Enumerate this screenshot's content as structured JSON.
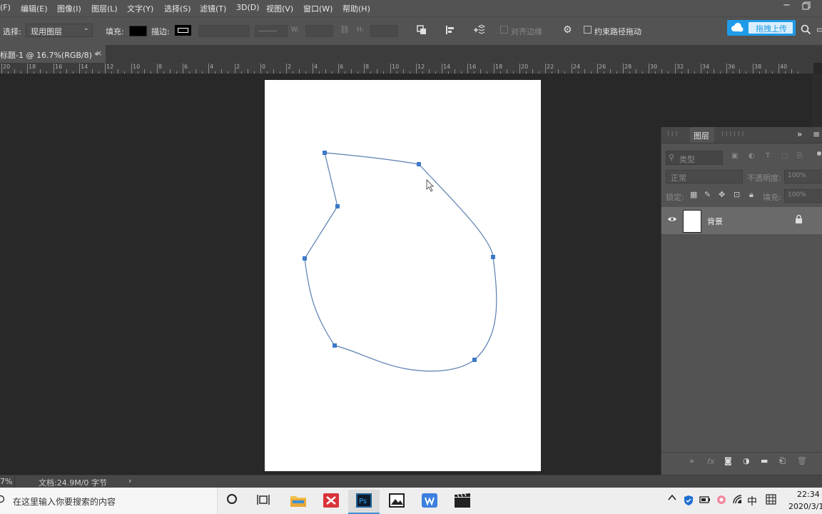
{
  "menu": {
    "items": [
      "(F)",
      "编辑(E)",
      "图像(I)",
      "图层(L)",
      "文字(Y)",
      "选择(S)",
      "滤镜(T)",
      "3D(D)",
      "视图(V)",
      "窗口(W)",
      "帮助(H)"
    ]
  },
  "options_bar": {
    "select_label": "选择:",
    "select_value": "现用图层",
    "fill_label": "填充:",
    "stroke_label": "描边:",
    "w_label": "W:",
    "h_label": "H:",
    "align_edges_label": "对齐边缘",
    "constrain_label": "约束路径拖动",
    "upload_button": "拖拽上传"
  },
  "document_tab": {
    "title": "标题-1 @ 16.7%(RGB/8) *",
    "close": "×"
  },
  "ruler": {
    "labels": [
      "20",
      "18",
      "16",
      "14",
      "12",
      "10",
      "8",
      "6",
      "4",
      "2",
      "0",
      "2",
      "4",
      "6",
      "8",
      "10",
      "12",
      "14",
      "16",
      "18",
      "20",
      "22",
      "24",
      "26",
      "28",
      "30",
      "32",
      "34",
      "36",
      "38",
      "40"
    ]
  },
  "layers_panel": {
    "tab_label": "图层",
    "search_placeholder": "类型",
    "blend_mode": "正常",
    "opacity_label": "不透明度:",
    "opacity_value": "100%",
    "lock_label": "锁定:",
    "fill_label": "填充:",
    "fill_value": "100%",
    "layer_name": "背景"
  },
  "status_bar": {
    "zoom": "7%",
    "doc_info": "文档:24.9M/0 字节"
  },
  "taskbar": {
    "search_text": "在这里输入你要搜索的内容",
    "ime": "中",
    "time": "22:34",
    "date": "2020/3/1"
  },
  "colors": {
    "menu_bg": "#535353",
    "workspace_bg": "#282828",
    "path_stroke": "#5b7fb0",
    "anchor": "#3c78c8",
    "upload_button_bg": "#1e9be8"
  }
}
